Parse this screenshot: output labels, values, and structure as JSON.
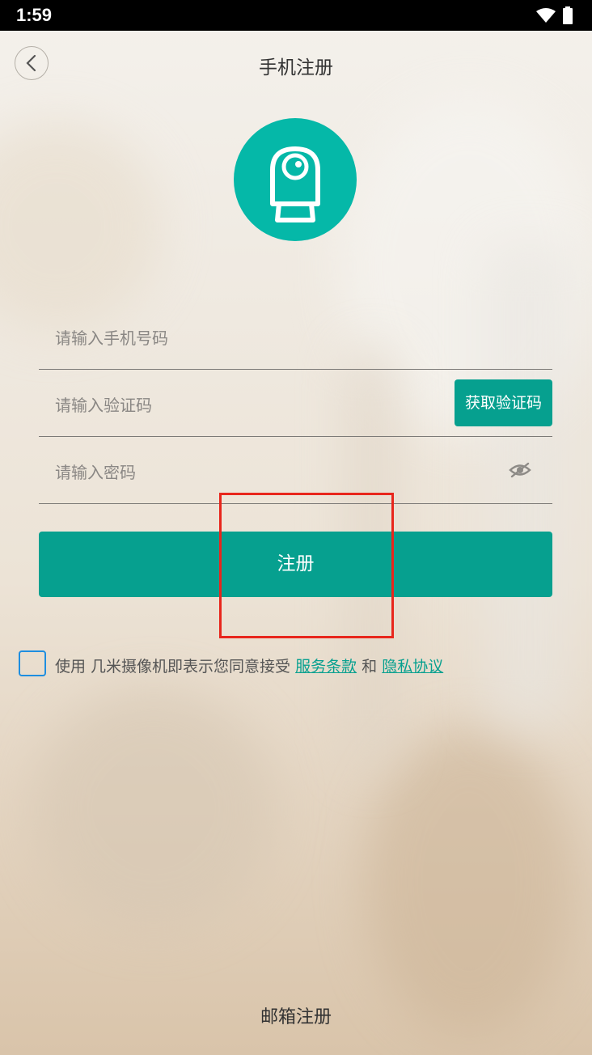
{
  "status_bar": {
    "time": "1:59",
    "icons": [
      "wifi-icon",
      "battery-icon"
    ]
  },
  "header": {
    "title": "手机注册",
    "back_icon": "chevron-left-icon"
  },
  "logo": {
    "icon": "camera-icon",
    "color": "#05b8a8"
  },
  "form": {
    "phone_placeholder": "请输入手机号码",
    "code_placeholder": "请输入验证码",
    "get_code_label": "获取验证码",
    "password_placeholder": "请输入密码",
    "password_toggle_icon": "eye-hidden-icon"
  },
  "register_button": {
    "label": "注册",
    "color": "#06a08f"
  },
  "agreement": {
    "prefix": "使用 几米摄像机即表示您同意接受 ",
    "terms_link": "服务条款",
    "conjunction": " 和 ",
    "privacy_link": "隐私协议"
  },
  "footer": {
    "email_register": "邮箱注册"
  },
  "highlight_color": "#e8261c"
}
